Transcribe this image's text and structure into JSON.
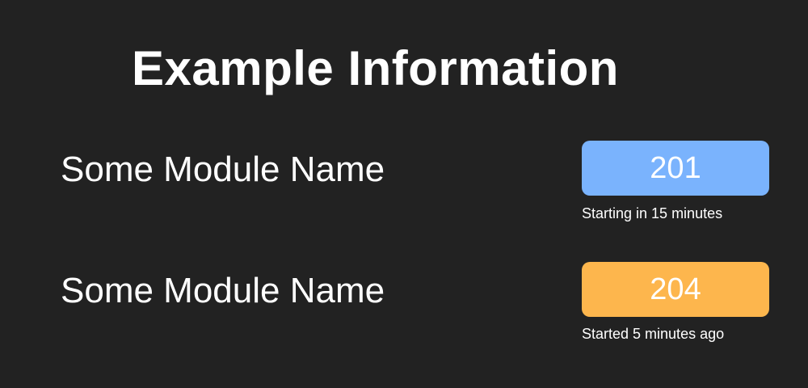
{
  "title": "Example Information",
  "modules": [
    {
      "name": "Some Module Name",
      "room": "201",
      "status": "Starting in 15 minutes",
      "badge_color": "#7ab3fd"
    },
    {
      "name": "Some Module Name",
      "room": "204",
      "status": "Started 5 minutes ago",
      "badge_color": "#fdb64d"
    }
  ],
  "colors": {
    "background": "#222222",
    "text": "#ffffff"
  }
}
